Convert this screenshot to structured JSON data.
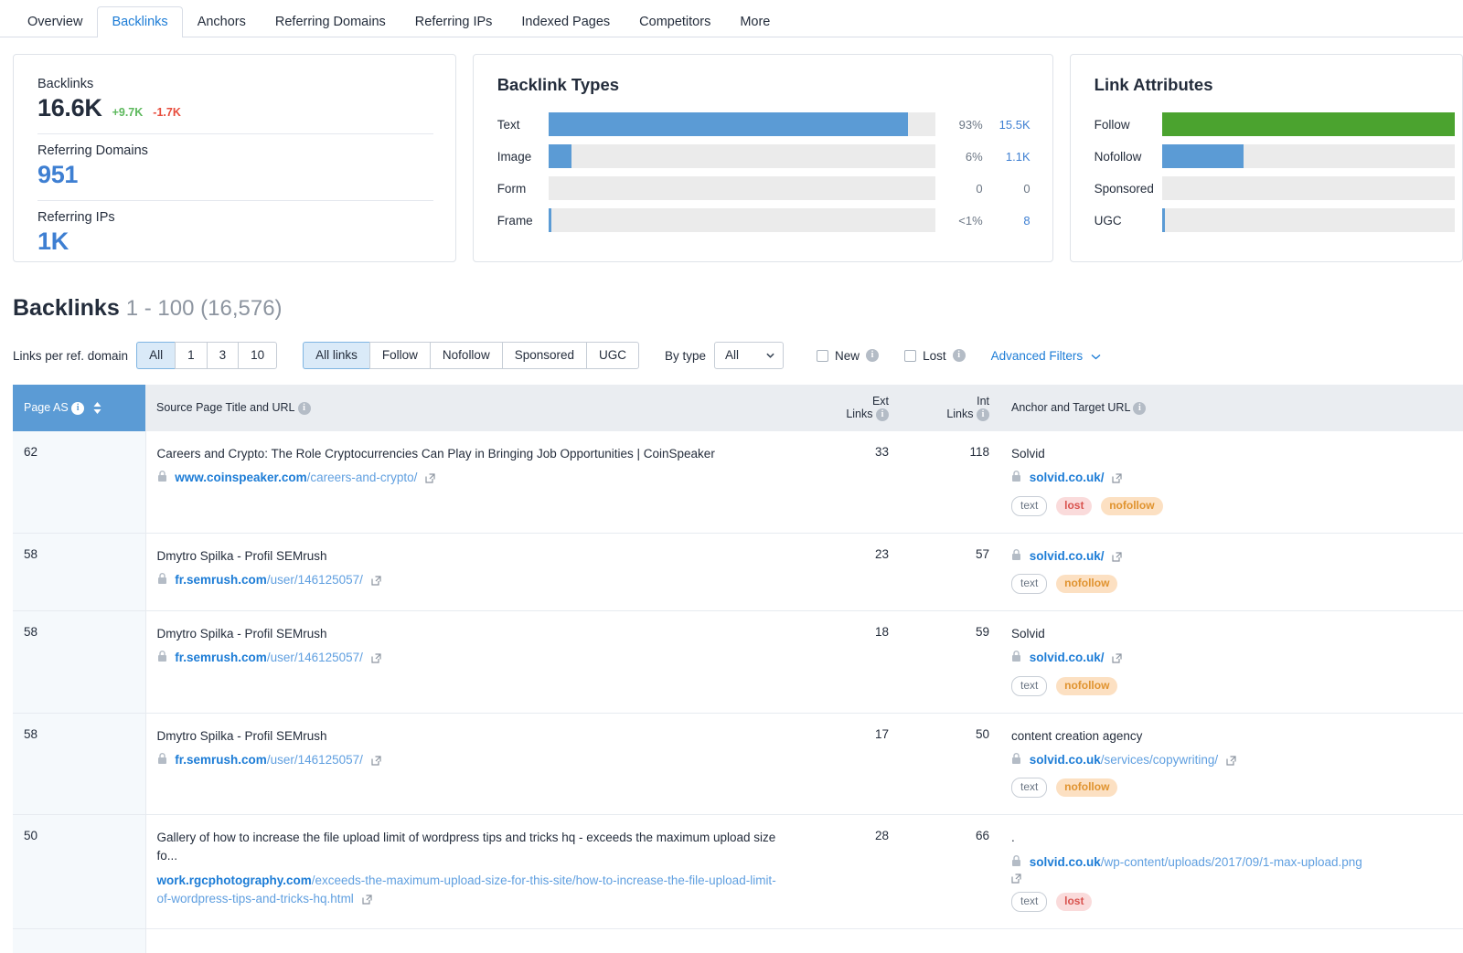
{
  "tabs": [
    {
      "label": "Overview",
      "active": false
    },
    {
      "label": "Backlinks",
      "active": true
    },
    {
      "label": "Anchors",
      "active": false
    },
    {
      "label": "Referring Domains",
      "active": false
    },
    {
      "label": "Referring IPs",
      "active": false
    },
    {
      "label": "Indexed Pages",
      "active": false
    },
    {
      "label": "Competitors",
      "active": false
    },
    {
      "label": "More",
      "active": false
    }
  ],
  "summary": {
    "backlinks_label": "Backlinks",
    "backlinks_value": "16.6K",
    "backlinks_gained": "+9.7K",
    "backlinks_lost": "-1.7K",
    "refdomains_label": "Referring Domains",
    "refdomains_value": "951",
    "refips_label": "Referring IPs",
    "refips_value": "1K"
  },
  "backlink_types": {
    "title": "Backlink Types"
  },
  "link_attributes": {
    "title": "Link Attributes"
  },
  "chart_data": [
    {
      "type": "bar",
      "title": "Backlink Types",
      "orientation": "horizontal",
      "categories": [
        "Text",
        "Image",
        "Form",
        "Frame"
      ],
      "values": [
        15500,
        1100,
        0,
        8
      ],
      "percent_labels": [
        "93%",
        "6%",
        "0",
        "<1%"
      ],
      "value_labels": [
        "15.5K",
        "1.1K",
        "0",
        "8"
      ],
      "fill_fractions": [
        0.93,
        0.06,
        0.0,
        0.006
      ],
      "bar_color": "#5b9bd5",
      "track_color": "#ebebeb",
      "xlabel": "",
      "ylabel": "",
      "grid": false,
      "legend": "none"
    },
    {
      "type": "bar",
      "title": "Link Attributes",
      "orientation": "horizontal",
      "categories": [
        "Follow",
        "Nofollow",
        "Sponsored",
        "UGC"
      ],
      "fill_fractions": [
        1.0,
        0.28,
        0.0,
        0.006
      ],
      "bar_colors": [
        "#4ba32f",
        "#5b9bd5",
        "#ebebeb",
        "#5b9bd5"
      ],
      "track_color": "#ebebeb",
      "note": "value and percent columns are clipped off the right edge of the screenshot",
      "xlabel": "",
      "ylabel": "",
      "grid": false,
      "legend": "none"
    }
  ],
  "section": {
    "title": "Backlinks",
    "count": "1 - 100 (16,576)"
  },
  "filters": {
    "links_per_domain_label": "Links per ref. domain",
    "links_per_domain_options": [
      "All",
      "1",
      "3",
      "10"
    ],
    "links_per_domain_selected": "All",
    "link_type_options": [
      "All links",
      "Follow",
      "Nofollow",
      "Sponsored",
      "UGC"
    ],
    "link_type_selected": "All links",
    "by_type_label": "By type",
    "by_type_value": "All",
    "new_label": "New",
    "lost_label": "Lost",
    "new_checked": false,
    "lost_checked": false,
    "advanced_label": "Advanced Filters"
  },
  "table": {
    "headers": {
      "page_as": "Page AS",
      "source": "Source Page Title and URL",
      "ext_links": "Ext\nLinks",
      "ext_links_l1": "Ext",
      "ext_links_l2": "Links",
      "int_links_l1": "Int",
      "int_links_l2": "Links",
      "anchor": "Anchor and Target URL"
    },
    "rows": [
      {
        "page_as": "62",
        "title": "Careers and Crypto: The Role Cryptocurrencies Can Play in Bringing Job Opportunities | CoinSpeaker",
        "src_domain": "www.coinspeaker.com",
        "src_path": "/careers-and-crypto/",
        "src_secure": true,
        "ext_links": "33",
        "int_links": "118",
        "anchor_text": "Solvid",
        "tgt_domain": "solvid.co.uk/",
        "tgt_path": "",
        "tgt_secure": true,
        "tags": [
          {
            "label": "text",
            "kind": "text"
          },
          {
            "label": "lost",
            "kind": "lost"
          },
          {
            "label": "nofollow",
            "kind": "nofollow"
          }
        ]
      },
      {
        "page_as": "58",
        "title": "Dmytro Spilka - Profil SEMrush",
        "src_domain": "fr.semrush.com",
        "src_path": "/user/146125057/",
        "src_secure": true,
        "ext_links": "23",
        "int_links": "57",
        "anchor_text": "",
        "tgt_domain": "solvid.co.uk/",
        "tgt_path": "",
        "tgt_secure": true,
        "tags": [
          {
            "label": "text",
            "kind": "text"
          },
          {
            "label": "nofollow",
            "kind": "nofollow"
          }
        ]
      },
      {
        "page_as": "58",
        "title": "Dmytro Spilka - Profil SEMrush",
        "src_domain": "fr.semrush.com",
        "src_path": "/user/146125057/",
        "src_secure": true,
        "ext_links": "18",
        "int_links": "59",
        "anchor_text": "Solvid",
        "tgt_domain": "solvid.co.uk/",
        "tgt_path": "",
        "tgt_secure": true,
        "tags": [
          {
            "label": "text",
            "kind": "text"
          },
          {
            "label": "nofollow",
            "kind": "nofollow"
          }
        ]
      },
      {
        "page_as": "58",
        "title": "Dmytro Spilka - Profil SEMrush",
        "src_domain": "fr.semrush.com",
        "src_path": "/user/146125057/",
        "src_secure": true,
        "ext_links": "17",
        "int_links": "50",
        "anchor_text": "content creation agency",
        "tgt_domain": "solvid.co.uk",
        "tgt_path": "/services/copywriting/",
        "tgt_secure": true,
        "tags": [
          {
            "label": "text",
            "kind": "text"
          },
          {
            "label": "nofollow",
            "kind": "nofollow"
          }
        ]
      },
      {
        "page_as": "50",
        "title": "Gallery of how to increase the file upload limit of wordpress tips and tricks hq - exceeds the maximum upload size fo...",
        "src_domain": "work.rgcphotography.com",
        "src_path": "/exceeds-the-maximum-upload-size-for-this-site/how-to-increase-the-file-upload-limit-of-wordpress-tips-and-tricks-hq.html",
        "src_secure": false,
        "ext_links": "28",
        "int_links": "66",
        "anchor_text": ".",
        "tgt_domain": "solvid.co.uk",
        "tgt_path": "/wp-content/uploads/2017/09/1-max-upload.png",
        "tgt_secure": true,
        "tags": [
          {
            "label": "text",
            "kind": "text"
          },
          {
            "label": "lost",
            "kind": "lost"
          }
        ]
      }
    ]
  }
}
